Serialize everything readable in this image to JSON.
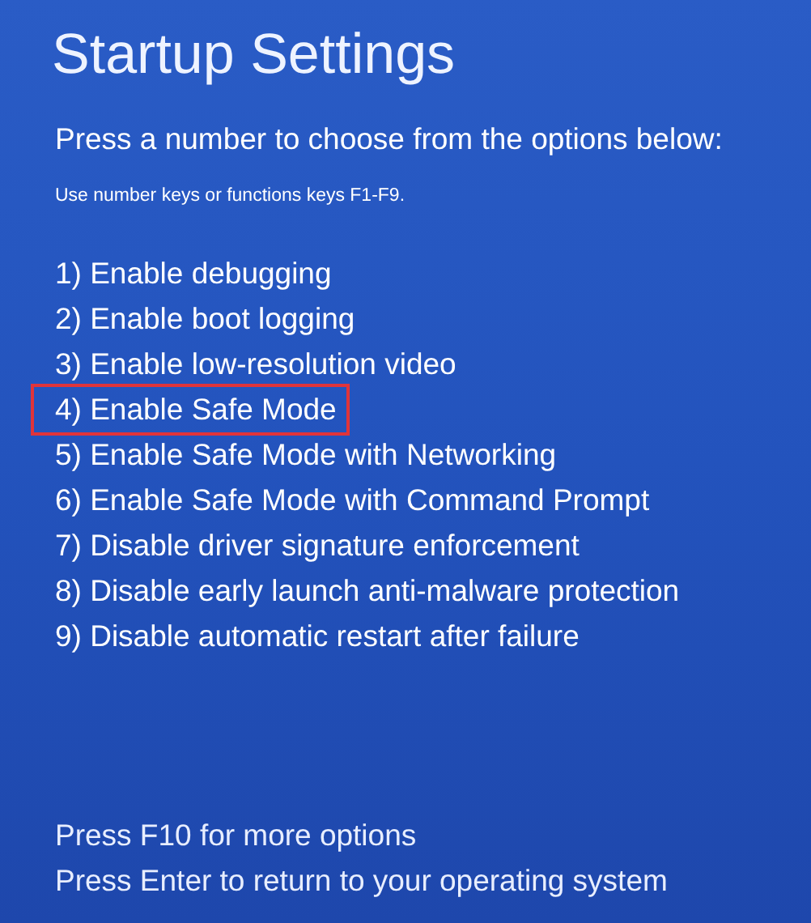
{
  "title": "Startup Settings",
  "prompt": "Press a number to choose from the options below:",
  "hint": "Use number keys or functions keys F1-F9.",
  "options": [
    {
      "label": "1) Enable debugging",
      "selected": false
    },
    {
      "label": "2) Enable boot logging",
      "selected": false
    },
    {
      "label": "3) Enable low-resolution video",
      "selected": false
    },
    {
      "label": "4) Enable Safe Mode",
      "selected": true
    },
    {
      "label": "5) Enable Safe Mode with Networking",
      "selected": false
    },
    {
      "label": "6) Enable Safe Mode with Command Prompt",
      "selected": false
    },
    {
      "label": "7) Disable driver signature enforcement",
      "selected": false
    },
    {
      "label": "8) Disable early launch anti-malware protection",
      "selected": false
    },
    {
      "label": "9) Disable automatic restart after failure",
      "selected": false
    }
  ],
  "footer": [
    "Press F10 for more options",
    "Press Enter to return to your operating system"
  ]
}
